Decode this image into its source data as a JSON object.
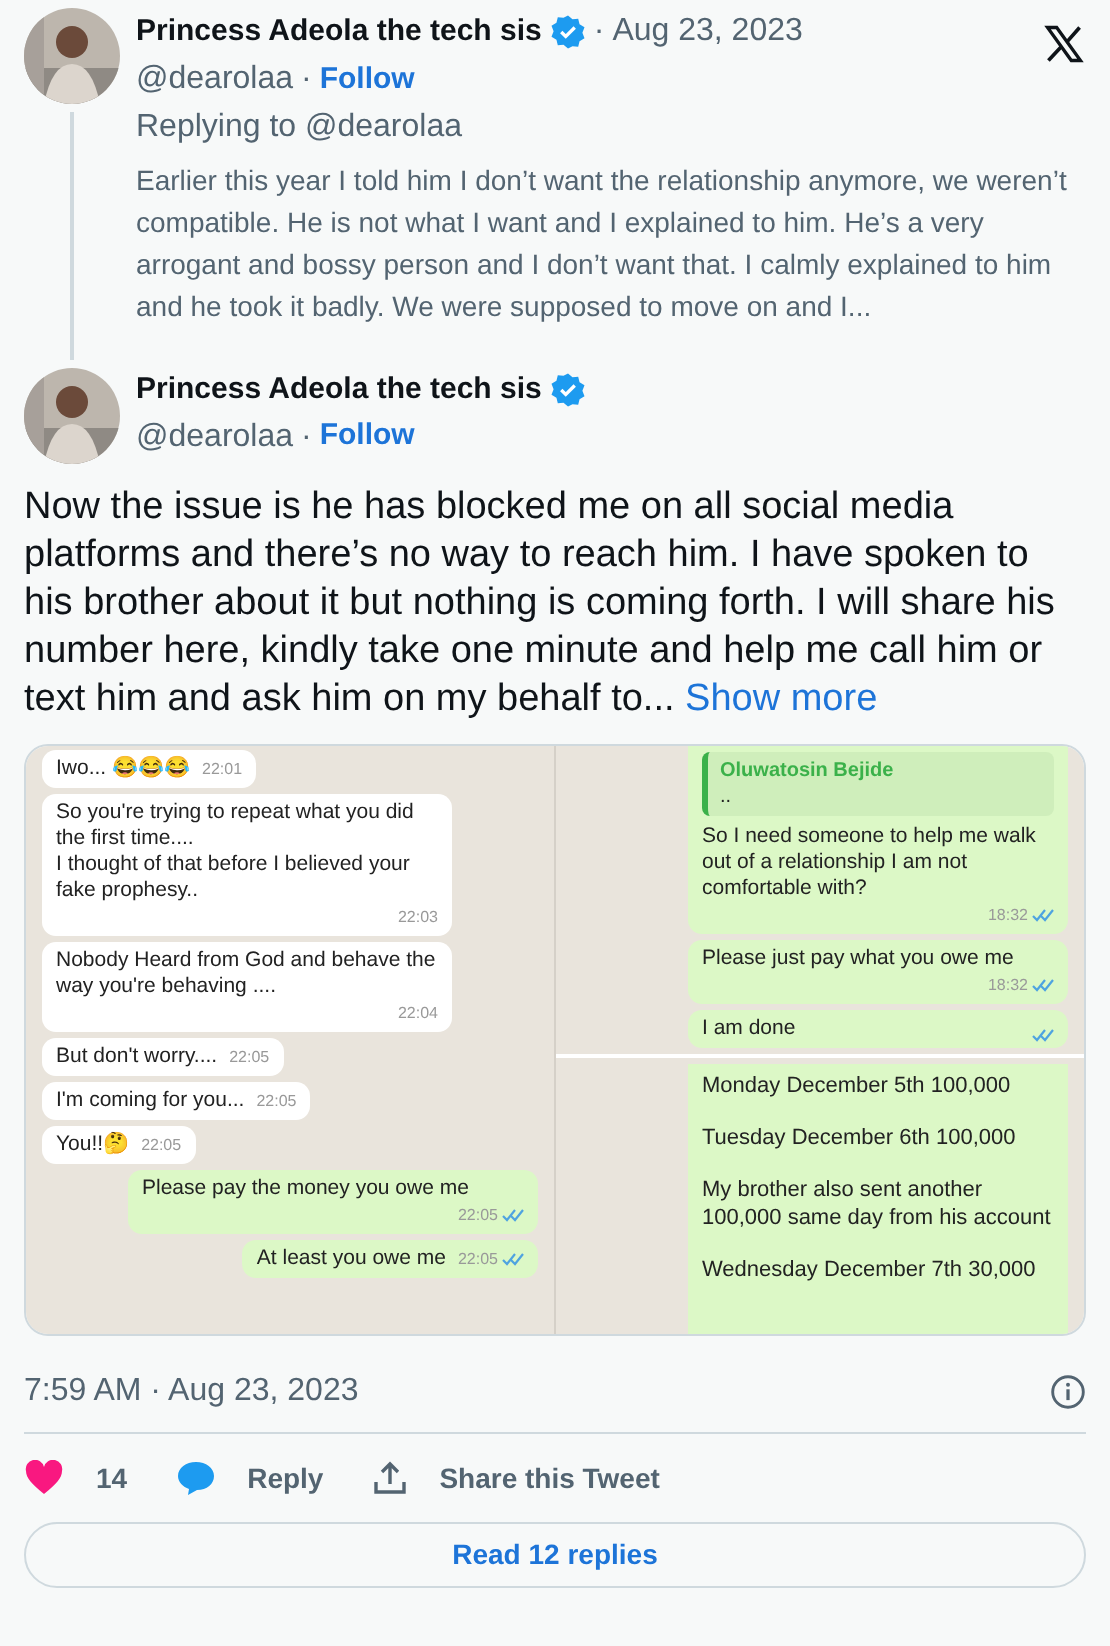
{
  "reply_tweet": {
    "author": "Princess Adeola the tech sis",
    "date_separator": "·",
    "date": "Aug 23, 2023",
    "handle": "@dearolaa",
    "handle_separator": "·",
    "follow": "Follow",
    "replying_to": "Replying to @dearolaa",
    "text": "Earlier this year I told him I don’t want the relationship anymore, we weren’t compatible. He is not what I want and I explained to him. He’s a very arrogant and bossy person and I don’t want that. I calmly explained to him and he took it badly. We were supposed to move on and I..."
  },
  "main_tweet": {
    "author": "Princess Adeola the tech sis",
    "handle": "@dearolaa",
    "handle_separator": "·",
    "follow": "Follow",
    "text": "Now the issue is he has blocked me on all social media platforms and there’s no way to reach him. I have spoken to his brother about it but nothing is coming forth. I will share his number here, kindly take one minute and help me call him or text him and ask him on my behalf to...",
    "show_more": "Show more"
  },
  "chat_left": [
    {
      "kind": "incoming",
      "text": "Iwo... 😂😂😂",
      "time": "22:01"
    },
    {
      "kind": "incoming",
      "text": "So you're trying to repeat what you did the first time....\nI thought of that before I believed your fake prophesy..",
      "time": "22:03"
    },
    {
      "kind": "incoming",
      "text": "Nobody Heard from God and behave the way you're behaving ....",
      "time": "22:04"
    },
    {
      "kind": "incoming",
      "text": "But don't worry....",
      "time": "22:05"
    },
    {
      "kind": "incoming",
      "text": "I'm coming for you...",
      "time": "22:05"
    },
    {
      "kind": "incoming",
      "text": "You!!🤔",
      "time": "22:05"
    },
    {
      "kind": "outgoing",
      "text": "Please pay the money you owe me",
      "time": "22:05"
    },
    {
      "kind": "outgoing",
      "text": "At least you owe me",
      "time": "22:05"
    }
  ],
  "chat_right": {
    "quote": {
      "name": "Oluwatosin Bejide",
      "text": ".."
    },
    "messages": [
      {
        "kind": "outgoing",
        "text": "So I need someone to help me walk out of a relationship I am not comfortable with?",
        "time": "18:32"
      },
      {
        "kind": "outgoing",
        "text": "Please just pay what you owe me",
        "time": "18:32"
      },
      {
        "kind": "outgoing",
        "text": "I am done"
      }
    ],
    "payments": [
      "Monday December 5th 100,000",
      "Tuesday December 6th 100,000",
      "My brother also sent another 100,000 same day from his account",
      "Wednesday December 7th 30,000"
    ]
  },
  "timestamp": "7:59 AM · Aug 23, 2023",
  "actions": {
    "likes": "14",
    "reply": "Reply",
    "share": "Share this Tweet"
  },
  "read_replies": "Read 12 replies"
}
